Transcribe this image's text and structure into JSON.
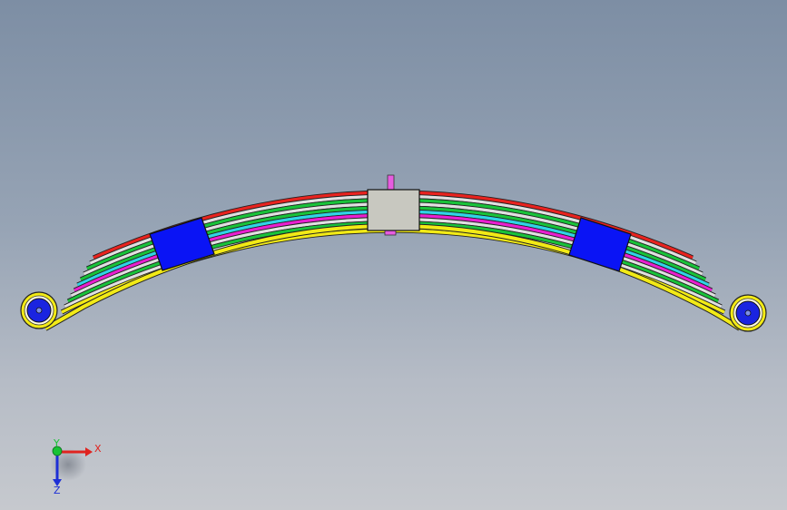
{
  "viewport": {
    "background_top": "#7d8ea4",
    "background_bottom": "#c6c9ce"
  },
  "model": {
    "leaf_colors": [
      "#e8231f",
      "#e0e0e0",
      "#19c23a",
      "#e0e0e0",
      "#19c23a",
      "#2fd4e6",
      "#e91fd0",
      "#e0e0e0",
      "#19c23a",
      "#e0e0e0",
      "#f2ea16"
    ],
    "clamp_color": "#0a14f5",
    "center_block_color": "#c8c8c0",
    "center_bolt_color": "#e75ce0",
    "eye_bushing_color": "#1a24e0",
    "eye_ring_color": "#f2ea16"
  },
  "triad": {
    "x_label": "X",
    "y_label": "Y",
    "z_label": "Z",
    "x_color": "#e0231f",
    "y_color": "#18c234",
    "z_color": "#1d2fd6"
  }
}
